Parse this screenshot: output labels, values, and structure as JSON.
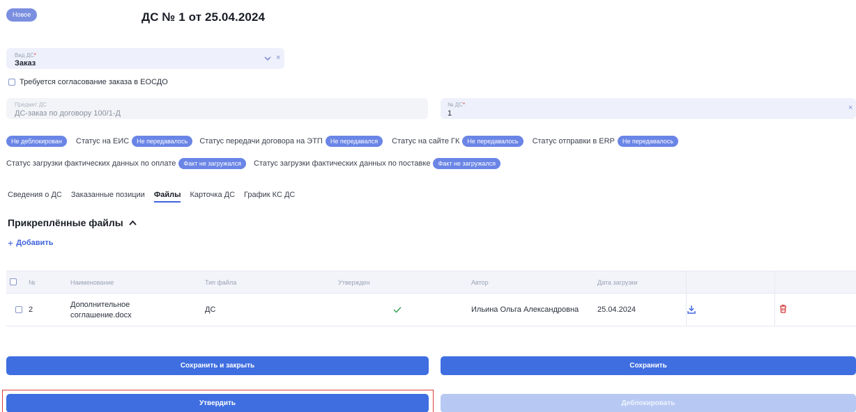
{
  "header": {
    "status_badge": "Новое",
    "title": "ДС № 1 от 25.04.2024"
  },
  "form": {
    "vid_ds": {
      "label": "Вид ДС",
      "required_mark": "*",
      "value": "Заказ"
    },
    "esodo_checkbox_label": "Требуется согласование заказа в ЕОСДО",
    "subject": {
      "label": "Предмет ДС",
      "value": "ДС-заказ по договору 100/1-Д"
    },
    "number": {
      "label": "№ ДС",
      "required_mark": "*",
      "value": "1"
    }
  },
  "statuses": {
    "row1": [
      {
        "label": "",
        "pill": "Не деблокирован"
      },
      {
        "label": "Статус на ЕИС",
        "pill": "Не передавалось"
      },
      {
        "label": "Статус передачи договора на ЭТП",
        "pill": "Не передавался"
      },
      {
        "label": "Статус на сайте ГК",
        "pill": "Не передавалось"
      },
      {
        "label": "Статус отправки в ERP",
        "pill": "Не передавалось"
      }
    ],
    "row2": [
      {
        "label": "Статус загрузки фактических данных по оплате",
        "pill": "Факт не загружался"
      },
      {
        "label": "Статус загрузки фактических данных по поставке",
        "pill": "Факт не загружался"
      }
    ]
  },
  "tabs": [
    {
      "label": "Сведения о ДС",
      "active": false
    },
    {
      "label": "Заказанные позиции",
      "active": false
    },
    {
      "label": "Файлы",
      "active": true
    },
    {
      "label": "Карточка ДС",
      "active": false
    },
    {
      "label": "График КС ДС",
      "active": false
    }
  ],
  "files_section": {
    "title": "Прикреплённые файлы",
    "add_label": "Добавить",
    "columns": [
      "№",
      "Наименование",
      "Тип файла",
      "Утвержден",
      "Автор",
      "Дата загрузки"
    ],
    "rows": [
      {
        "num": "2",
        "name_line1": "Дополнительное",
        "name_line2": "соглашение.docx",
        "type": "ДС",
        "approved": true,
        "author": "Ильина Ольга Александровна",
        "date": "25.04.2024"
      }
    ]
  },
  "buttons": {
    "save_close": "Сохранить и закрыть",
    "save": "Сохранить",
    "approve": "Утвердить",
    "unblock": "Деблокировать"
  },
  "colors": {
    "accent": "#3f6ee0",
    "pill": "#6a85e6",
    "highlight": "#e03a3a"
  }
}
